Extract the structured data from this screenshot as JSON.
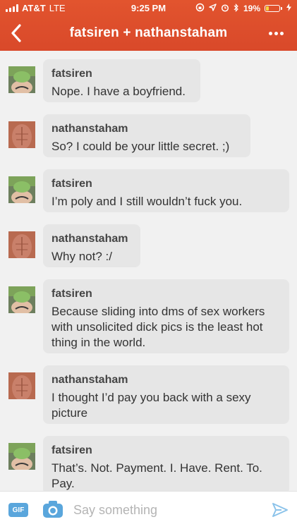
{
  "status_bar": {
    "carrier": "AT&T",
    "network": "LTE",
    "time": "9:25 PM",
    "battery_percent": "19%",
    "battery_level": 0.19,
    "icons": [
      "signal-icon",
      "lock-rotation-icon",
      "location-icon",
      "alarm-icon",
      "bluetooth-icon",
      "battery-icon",
      "charging-icon"
    ]
  },
  "header": {
    "title": "fatsiren + nathanstaham",
    "back_icon": "chevron-left-icon",
    "more_icon": "more-dots-icon"
  },
  "colors": {
    "header": "#e2542e",
    "bubble": "#e6e6e6",
    "background": "#f1f1f1",
    "accent": "#5aa6dc"
  },
  "messages": [
    {
      "user": "fatsiren",
      "text": "Nope. I have a boyfriend."
    },
    {
      "user": "nathanstaham",
      "text": "So? I could be your little secret. ;)"
    },
    {
      "user": "fatsiren",
      "text": "I’m poly and I still wouldn’t fuck you."
    },
    {
      "user": "nathanstaham",
      "text": "Why not? :/"
    },
    {
      "user": "fatsiren",
      "text": "Because sliding into dms of sex workers with unsolicited dick pics is the least hot thing in the world."
    },
    {
      "user": "nathanstaham",
      "text": "I thought I’d pay you back with a sexy picture"
    },
    {
      "user": "fatsiren",
      "text": "That’s. Not. Payment. I. Have. Rent. To. Pay."
    }
  ],
  "composer": {
    "gif_label": "GIF",
    "placeholder": "Say something",
    "value": ""
  }
}
